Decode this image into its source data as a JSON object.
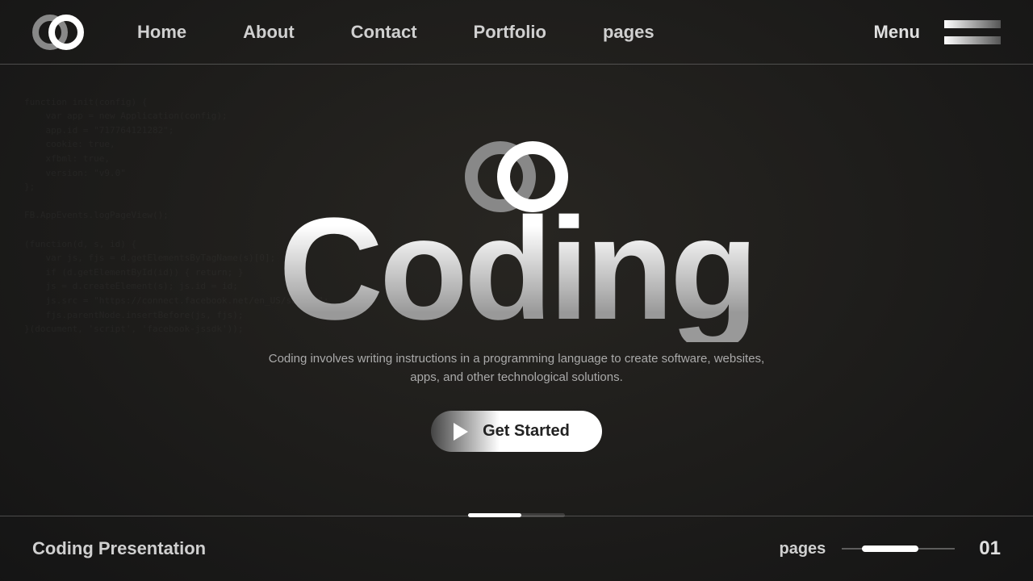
{
  "nav": {
    "items": [
      "Home",
      "About",
      "Contact",
      "Portfolio",
      "pages"
    ],
    "menu_label": "Menu"
  },
  "hero": {
    "title": "Coding",
    "description": "Coding involves writing instructions in a programming language to create software, websites, apps, and other technological solutions.",
    "cta_label": "Get Started"
  },
  "footer": {
    "title": "Coding Presentation",
    "pages_label": "pages",
    "page_number": "01"
  }
}
